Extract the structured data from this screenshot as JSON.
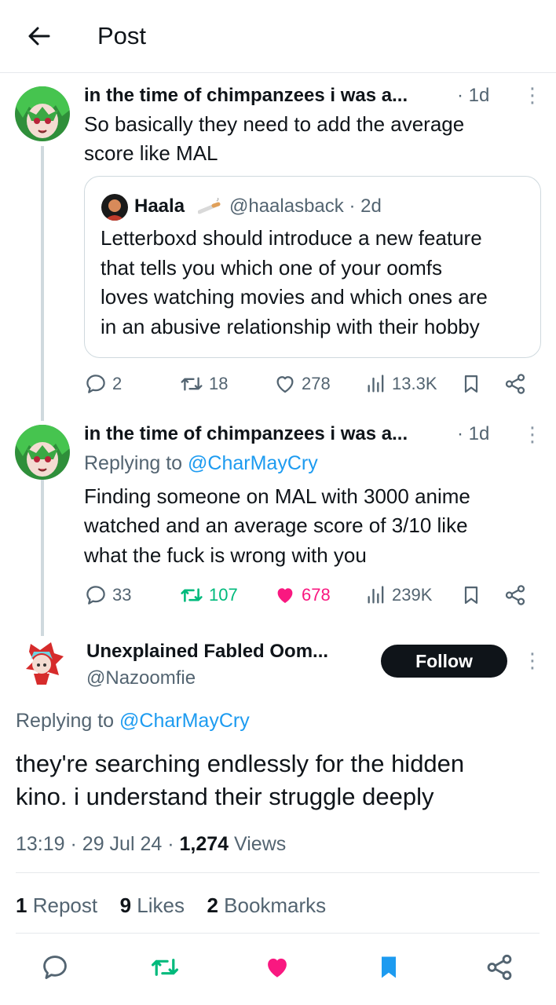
{
  "header": {
    "title": "Post"
  },
  "tweet1": {
    "name": "in the time of chimpanzees i was a...",
    "time": "· 1d",
    "text_line1": "So basically they need to add the average",
    "text_line2": "score like MAL",
    "quote": {
      "name": "Haala",
      "handle_time": "@haalasback · 2d",
      "lines": [
        "Letterboxd should introduce a new feature",
        "that tells you which one of your oomfs",
        "loves watching movies and which ones are",
        "in an abusive relationship with their hobby"
      ]
    },
    "stats": {
      "replies": "2",
      "reposts": "18",
      "likes": "278",
      "views": "13.3K"
    }
  },
  "tweet2": {
    "name": "in the time of chimpanzees i was a...",
    "time": "· 1d",
    "replying_prefix": "Replying to",
    "replying_handle": "@CharMayCry",
    "lines": [
      "Finding someone on MAL with 3000 anime",
      "watched and an average score of 3/10 like",
      "what the fuck is wrong with you"
    ],
    "stats": {
      "replies": "33",
      "reposts": "107",
      "likes": "678",
      "views": "239K"
    }
  },
  "main": {
    "name": "Unexplained Fabled Oom...",
    "handle": "@Nazoomfie",
    "follow_label": "Follow",
    "replying_prefix": "Replying to",
    "replying_handle": "@CharMayCry",
    "line1": "they're searching endlessly for the hidden",
    "line2": "kino. i understand their struggle deeply",
    "time": "13:19",
    "date": "29 Jul 24",
    "views_count": "1,274",
    "views_label": "Views",
    "reposts_count": "1",
    "reposts_label": "Repost",
    "likes_count": "9",
    "likes_label": "Likes",
    "bookmarks_count": "2",
    "bookmarks_label": "Bookmarks"
  },
  "colors": {
    "accent": "#1d9bf0",
    "repost_active": "#00ba7c",
    "like_active": "#f91880",
    "bookmark_active": "#1d9bf0"
  }
}
